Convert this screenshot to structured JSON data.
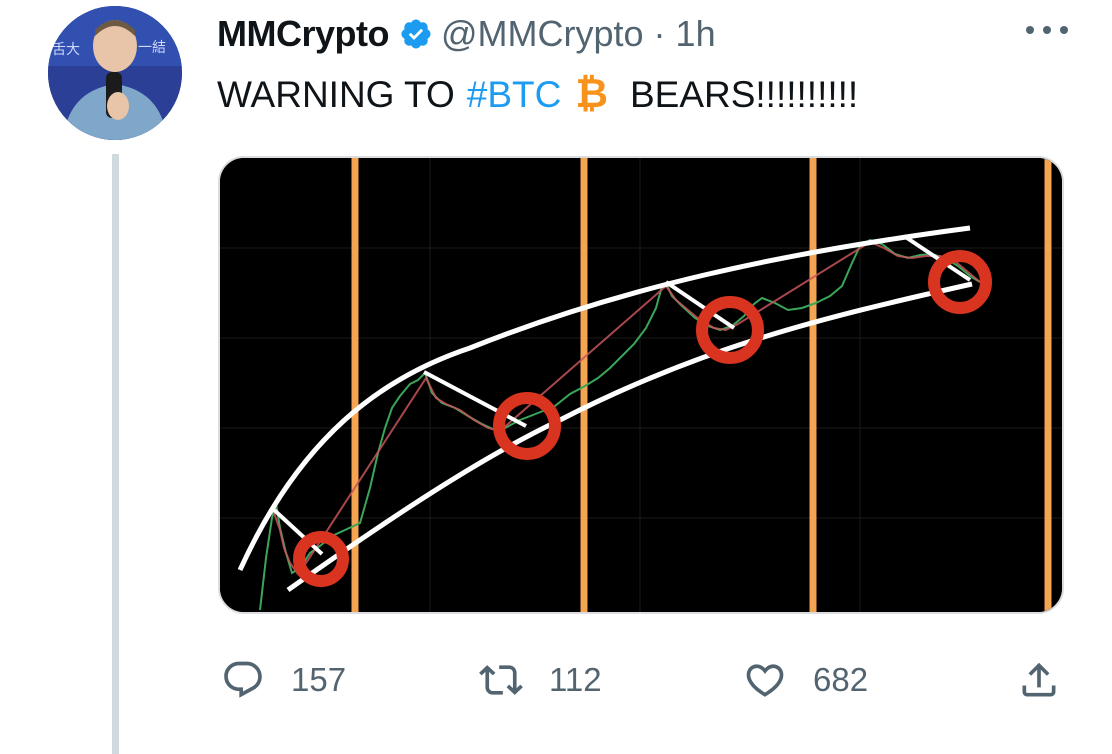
{
  "tweet": {
    "author": {
      "display_name": "MMCrypto",
      "handle": "@MMCrypto",
      "verified": true,
      "time": "1h"
    },
    "text": {
      "prefix": "WARNING TO",
      "hashtag": "#BTC",
      "emoji": "₿",
      "suffix": "BEARS!!!!!!!!!!"
    },
    "stats": {
      "replies": "157",
      "retweets": "112",
      "likes": "682"
    }
  },
  "colors": {
    "accent": "#1d9bf0",
    "muted": "#536471",
    "bitcoin": "#f7931a",
    "chart_orange": "#f5a451",
    "chart_circle": "#d9341f"
  },
  "icons": [
    "verified-badge-icon",
    "more-icon",
    "reply-icon",
    "retweet-icon",
    "like-icon",
    "share-icon",
    "bitcoin-icon"
  ]
}
